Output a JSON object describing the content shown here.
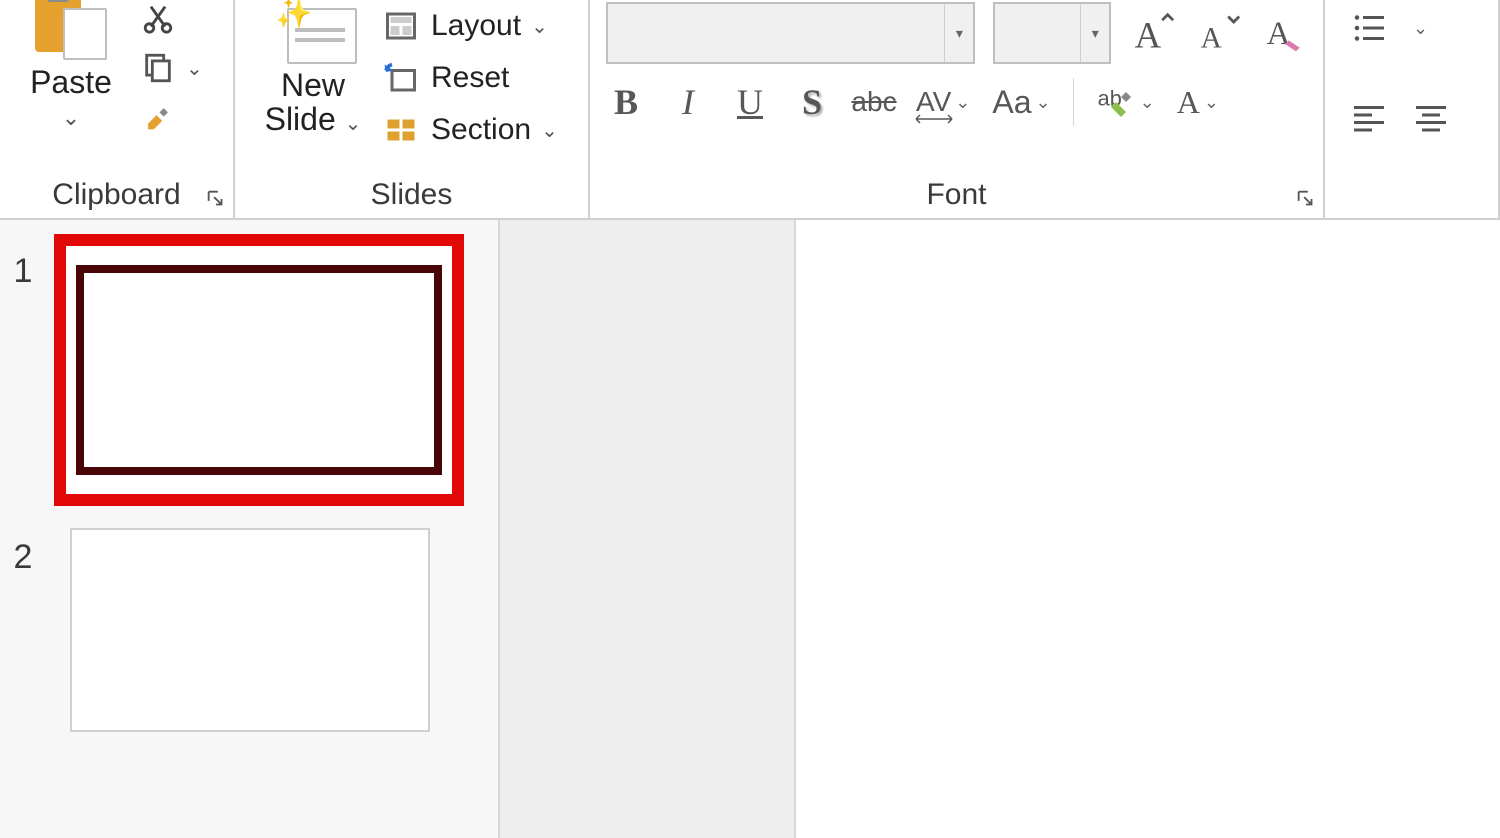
{
  "clipboard": {
    "paste_label": "Paste",
    "group_label": "Clipboard"
  },
  "slides": {
    "new_slide_label": "New\nSlide",
    "layout_label": "Layout",
    "reset_label": "Reset",
    "section_label": "Section",
    "group_label": "Slides"
  },
  "font": {
    "name_value": "",
    "size_value": "",
    "group_label": "Font",
    "bold": "B",
    "italic": "I",
    "underline": "U",
    "shadow": "S",
    "strike": "abc",
    "spacing": "AV",
    "case": "Aa",
    "color": "A"
  },
  "thumbs": {
    "n1": "1",
    "n2": "2"
  }
}
